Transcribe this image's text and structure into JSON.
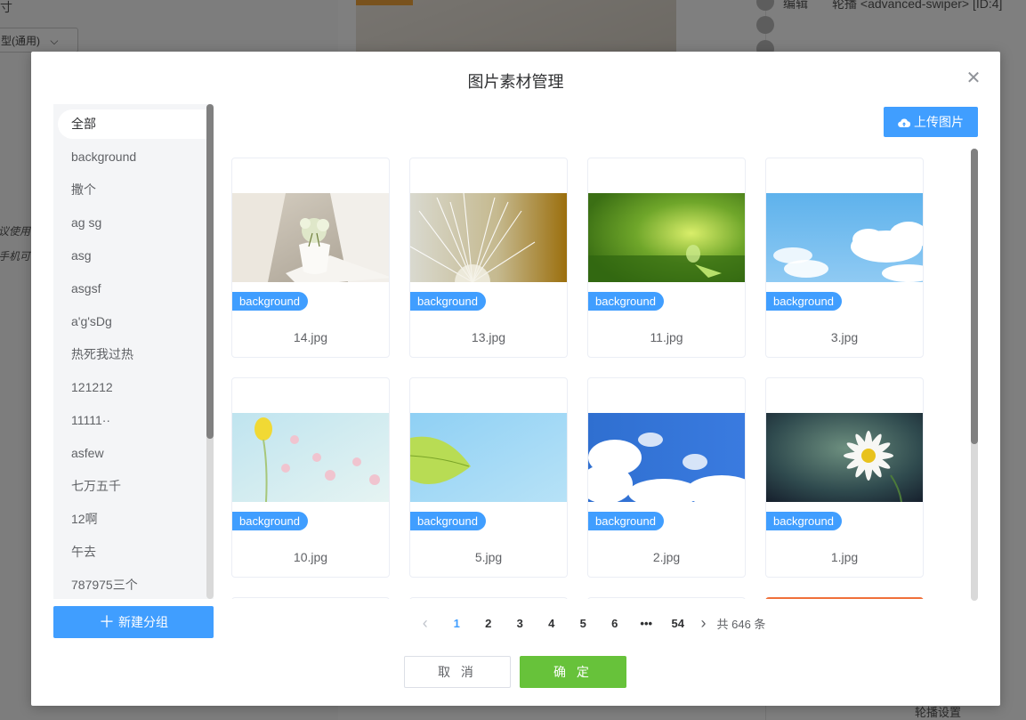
{
  "background_app": {
    "fragments": [
      "寸",
      "型(通用)",
      "议使用",
      "手机可",
      "编辑",
      "轮播 <advanced-swiper> [ID:4]",
      "轮播设置"
    ]
  },
  "modal": {
    "title": "图片素材管理",
    "close_icon": "close-icon",
    "upload_label": "上传图片",
    "new_group_label": "新建分组",
    "cancel_label": "取 消",
    "ok_label": "确 定"
  },
  "groups": [
    {
      "label": "全部",
      "active": true
    },
    {
      "label": "background"
    },
    {
      "label": "撒个"
    },
    {
      "label": "ag sg"
    },
    {
      "label": "asg"
    },
    {
      "label": "asgsf"
    },
    {
      "label": "a'g'sDg"
    },
    {
      "label": "热死我过热"
    },
    {
      "label": "121212"
    },
    {
      "label": "11111··"
    },
    {
      "label": "asfew"
    },
    {
      "label": "七万五千"
    },
    {
      "label": "12啊"
    },
    {
      "label": "午去"
    },
    {
      "label": "787975三个"
    }
  ],
  "images": [
    {
      "name": "14.jpg",
      "tag": "background",
      "thumb": "cup-flowers"
    },
    {
      "name": "13.jpg",
      "tag": "background",
      "thumb": "dandelion"
    },
    {
      "name": "11.jpg",
      "tag": "background",
      "thumb": "green-drop"
    },
    {
      "name": "3.jpg",
      "tag": "background",
      "thumb": "sky-clouds"
    },
    {
      "name": "10.jpg",
      "tag": "background",
      "thumb": "pastel-flowers"
    },
    {
      "name": "5.jpg",
      "tag": "background",
      "thumb": "green-leaf"
    },
    {
      "name": "2.jpg",
      "tag": "background",
      "thumb": "blue-sky"
    },
    {
      "name": "1.jpg",
      "tag": "background",
      "thumb": "daisy"
    }
  ],
  "pagination": {
    "pages": [
      "1",
      "2",
      "3",
      "4",
      "5",
      "6",
      "•••",
      "54"
    ],
    "current": "1",
    "total_text": "共 646 条"
  },
  "colors": {
    "primary": "#409eff",
    "success": "#67c23a",
    "text": "#606266"
  }
}
